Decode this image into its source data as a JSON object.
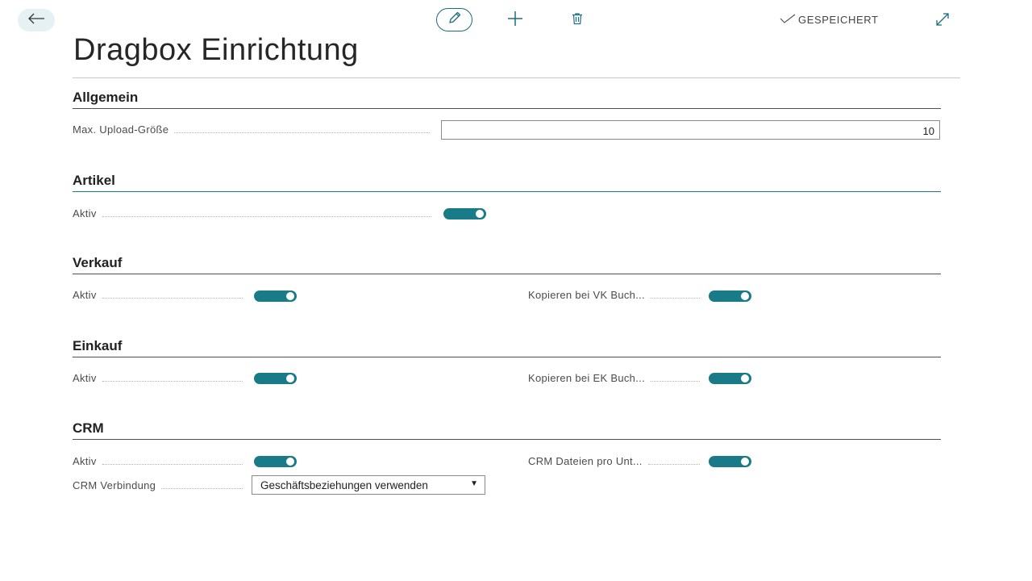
{
  "toolbar": {
    "saved_label": "GESPEICHERT"
  },
  "page": {
    "title": "Dragbox Einrichtung"
  },
  "sections": {
    "allgemein": {
      "title": "Allgemein",
      "max_upload_label": "Max. Upload-Größe",
      "max_upload_value": "10"
    },
    "artikel": {
      "title": "Artikel",
      "aktiv_label": "Aktiv",
      "aktiv_value": true
    },
    "verkauf": {
      "title": "Verkauf",
      "aktiv_label": "Aktiv",
      "aktiv_value": true,
      "kopieren_label": "Kopieren bei VK Buch...",
      "kopieren_value": true
    },
    "einkauf": {
      "title": "Einkauf",
      "aktiv_label": "Aktiv",
      "aktiv_value": true,
      "kopieren_label": "Kopieren bei EK Buch...",
      "kopieren_value": true
    },
    "crm": {
      "title": "CRM",
      "aktiv_label": "Aktiv",
      "aktiv_value": true,
      "dateien_label": "CRM Dateien pro Unt...",
      "dateien_value": true,
      "verbindung_label": "CRM Verbindung",
      "verbindung_value": "Geschäftsbeziehungen verwenden"
    }
  },
  "colors": {
    "accent": "#197b87",
    "back_button_bg": "#e6f1f4"
  },
  "icons": {
    "back": "arrow-left-icon",
    "edit": "pencil-icon",
    "new": "plus-icon",
    "delete": "trash-icon",
    "saved": "checkmark-icon",
    "expand": "expand-icon",
    "dropdown": "caret-down-icon"
  }
}
